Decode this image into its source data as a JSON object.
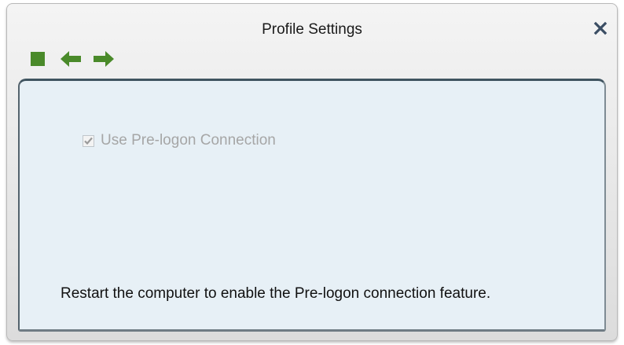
{
  "window": {
    "title": "Profile Settings"
  },
  "toolbar": {
    "icons": [
      "stop-icon",
      "back-arrow-icon",
      "forward-arrow-icon"
    ],
    "icon_color": "#4a8a2a"
  },
  "content": {
    "prelogon_checkbox": {
      "label": "Use Pre-logon Connection",
      "checked": true,
      "disabled": true
    },
    "notice_text": "Restart the computer to enable the Pre-logon connection feature."
  },
  "colors": {
    "panel_background": "#e7f0f6",
    "panel_border": "#3f5460",
    "disabled_text": "#a6a6a6"
  }
}
